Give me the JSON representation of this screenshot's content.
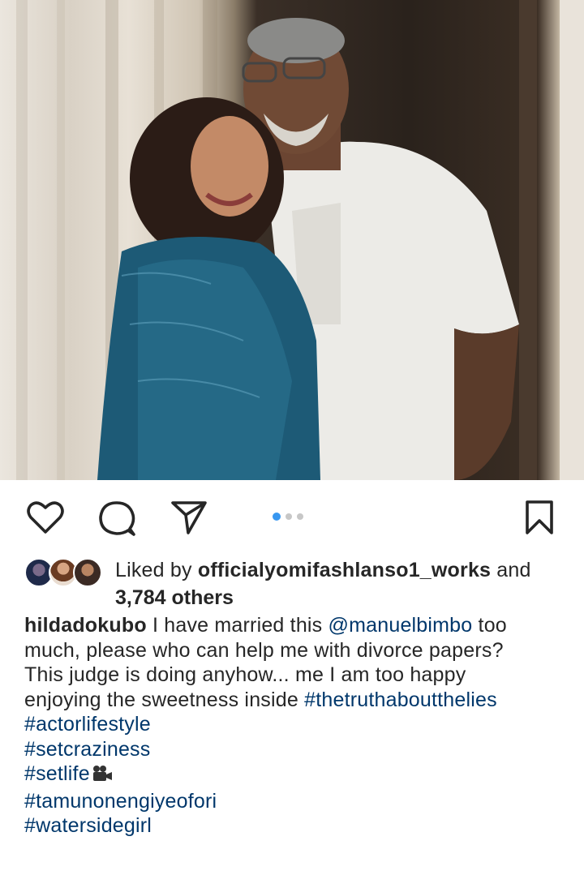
{
  "post": {
    "photo_icon": "photo-image",
    "carousel": {
      "count": 3,
      "active": 1
    }
  },
  "actions": {
    "like_icon": "heart-icon",
    "comment_icon": "comment-icon",
    "share_icon": "share-icon",
    "save_icon": "bookmark-icon"
  },
  "likes": {
    "prefix": "Liked by ",
    "user": "officialyomifashlanso1_works",
    "middle": " and",
    "count": "3,784 others"
  },
  "caption": {
    "username": "hildadokubo",
    "line1_text": " I have married this ",
    "mention": "@manuelbimbo",
    "line1_end": " too",
    "line2": "much, please who can help me with divorce papers?",
    "line3": "This judge is doing anyhow... me I am too happy",
    "line4_text": "enjoying the sweetness inside ",
    "line4_tag": "#thetruthaboutthelies",
    "tags": [
      "#actorlifestyle",
      "#setcraziness",
      "#setlife",
      "#tamunonengiyeofori",
      "#watersidegirl"
    ]
  },
  "colors": {
    "accent": "#3897f0",
    "link": "#00376b",
    "text": "#262626"
  }
}
